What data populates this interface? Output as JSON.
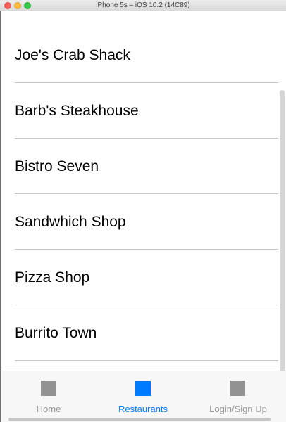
{
  "window": {
    "title": "iPhone 5s – iOS 10.2 (14C89)"
  },
  "restaurants": [
    {
      "name": "Joe's Crab Shack"
    },
    {
      "name": "Barb's Steakhouse"
    },
    {
      "name": "Bistro Seven"
    },
    {
      "name": "Sandwhich Shop"
    },
    {
      "name": "Pizza Shop"
    },
    {
      "name": "Burrito Town"
    }
  ],
  "tabbar": {
    "tabs": [
      {
        "label": "Home",
        "icon": "square-placeholder-icon",
        "active": false
      },
      {
        "label": "Restaurants",
        "icon": "square-placeholder-icon",
        "active": true
      },
      {
        "label": "Login/Sign Up",
        "icon": "square-placeholder-icon",
        "active": false
      }
    ],
    "active_color": "#007aff",
    "inactive_color": "#929292"
  }
}
